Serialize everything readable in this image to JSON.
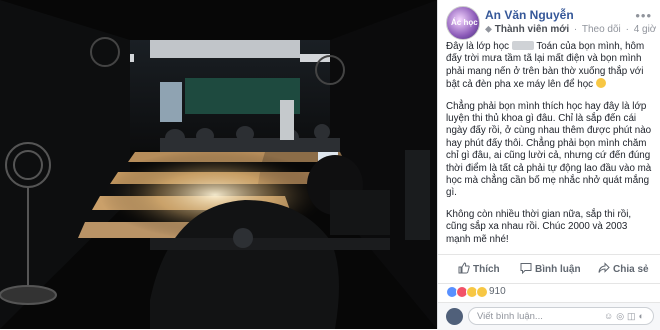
{
  "post": {
    "author": "An Văn Nguyễn",
    "badge": "Thành viên mới",
    "follow": "Theo dõi",
    "dot": "·",
    "time": "4 giờ",
    "globe": "·",
    "more_icon": "more-icon",
    "avatar_text": "Ác học",
    "paragraphs": {
      "p1_a": "Đây là lớp học ",
      "p1_b": " Toán của bọn mình, hôm đấy trời mưa tầm tã lại mất điện và bọn mình phải mang nến ở trên bàn thờ xuống thắp với bật cả đèn pha xe máy lên để học ",
      "p2": "Chẳng phải bọn mình thích học hay đây là lớp luyện thi thủ khoa gì đâu. Chỉ là sắp đến cái ngày đấy rồi, ở cùng nhau thêm được phút nào hay phút đấy thôi. Chẳng phải bọn mình chăm chỉ gì đâu, ai cũng lười cả, nhưng cứ đến đúng thời điểm là tất cả phải tự động lao đầu vào mà học mà chẳng cần bố mẹ nhắc nhở quát mắng gì.",
      "p3": "Không còn nhiều thời gian nữa, sắp thi rồi, cũng sắp xa nhau rồi. Chúc 2000 và 2003 mạnh mẽ nhé!"
    },
    "actions": {
      "like": "Thích",
      "comment": "Bình luận",
      "share": "Chia sẻ"
    },
    "reactions": {
      "count": "910",
      "like_color": "#5890ff",
      "love_color": "#f25268",
      "haha_color": "#f7c744"
    },
    "comment_box": {
      "placeholder": "Viết bình luận..."
    }
  },
  "colors": {
    "link": "#365899",
    "text": "#1d2129",
    "muted": "#90949c"
  }
}
